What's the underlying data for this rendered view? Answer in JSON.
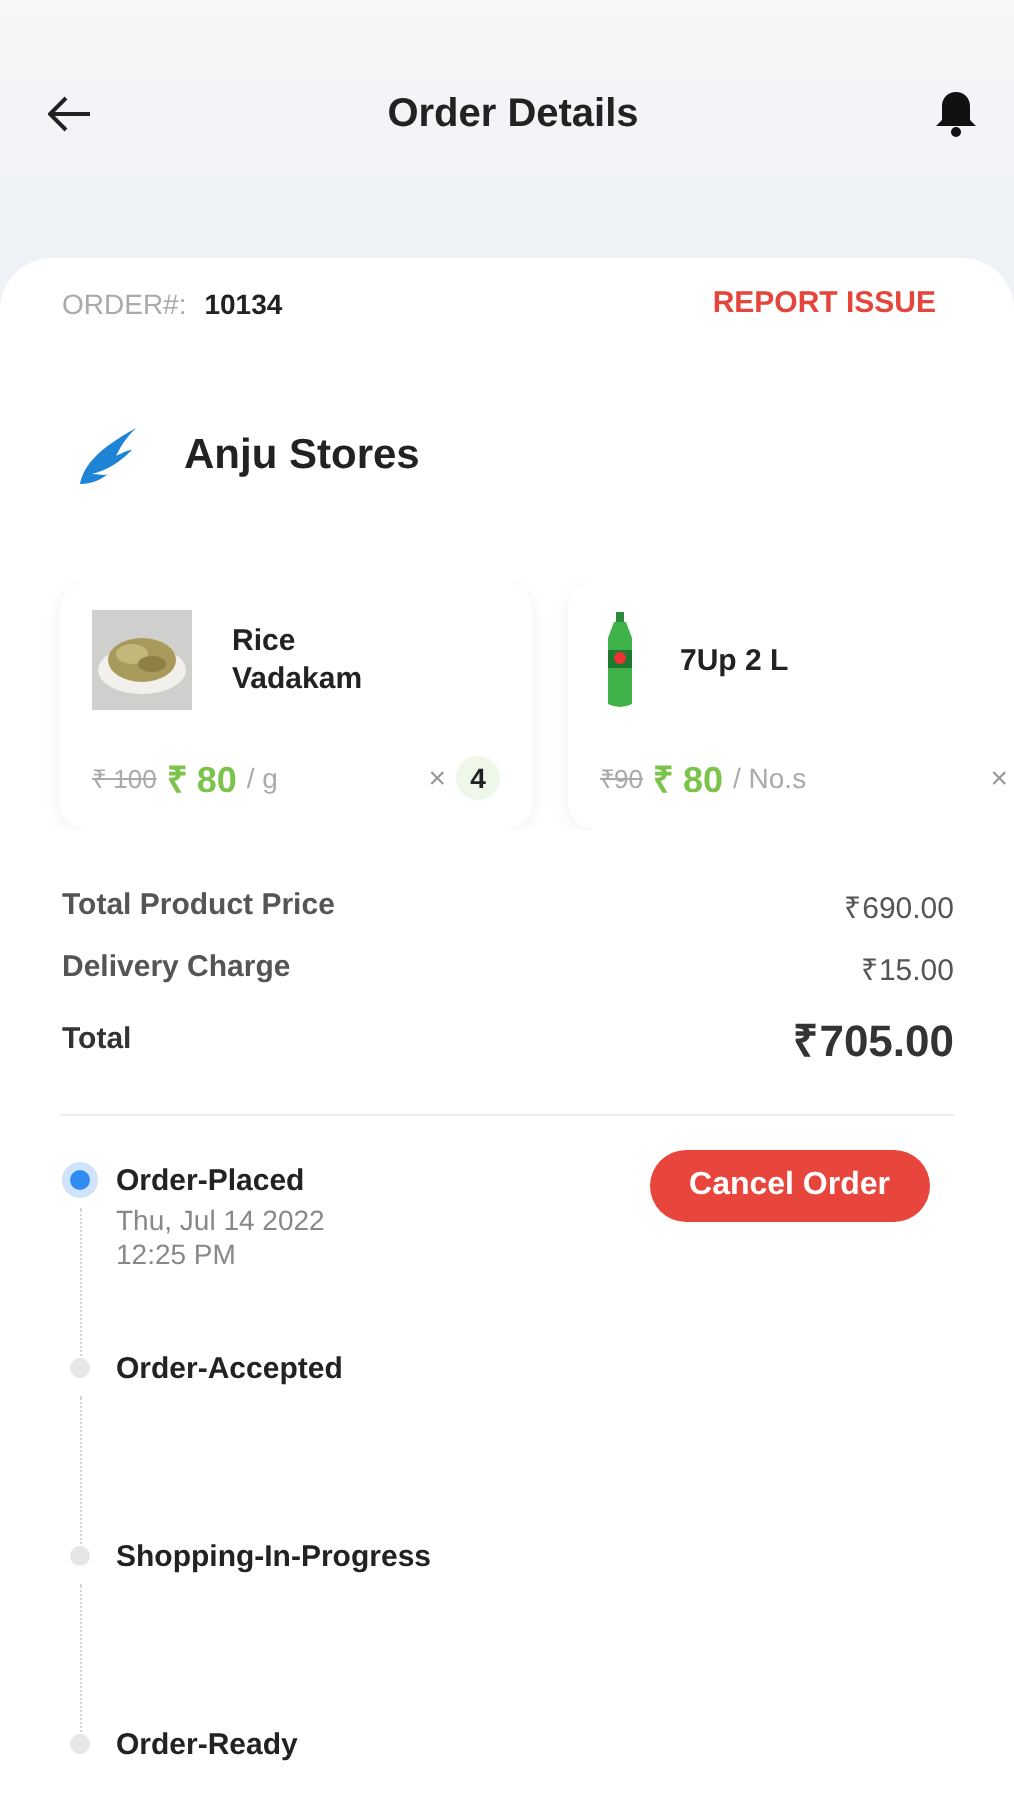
{
  "header": {
    "title": "Order Details"
  },
  "order": {
    "label": "ORDER#:",
    "number": "10134",
    "action": "REPORT ISSUE"
  },
  "store": {
    "name": "Anju Stores"
  },
  "products": [
    {
      "name": "Rice Vadakam",
      "old_price": "₹ 100",
      "price": "₹ 80",
      "unit": "/ g",
      "times": "×",
      "quantity": "4"
    },
    {
      "name": "7Up 2 L",
      "old_price": "₹90",
      "price": "₹ 80",
      "unit": "/ No.s",
      "times": "×"
    }
  ],
  "summary": [
    {
      "label": "Total Product Price",
      "value": "₹690.00",
      "kind": "line"
    },
    {
      "label": "Delivery Charge",
      "value": "₹15.00",
      "kind": "line"
    },
    {
      "label": "Total",
      "value": "₹705.00",
      "kind": "total"
    }
  ],
  "timeline": [
    {
      "title": "Order-Placed",
      "date": "Thu, Jul 14 2022",
      "time": "12:25 PM",
      "active": true,
      "action": "Cancel Order"
    },
    {
      "title": "Order-Accepted",
      "active": false
    },
    {
      "title": "Shopping-In-Progress",
      "active": false
    },
    {
      "title": "Order-Ready",
      "active": false
    }
  ]
}
